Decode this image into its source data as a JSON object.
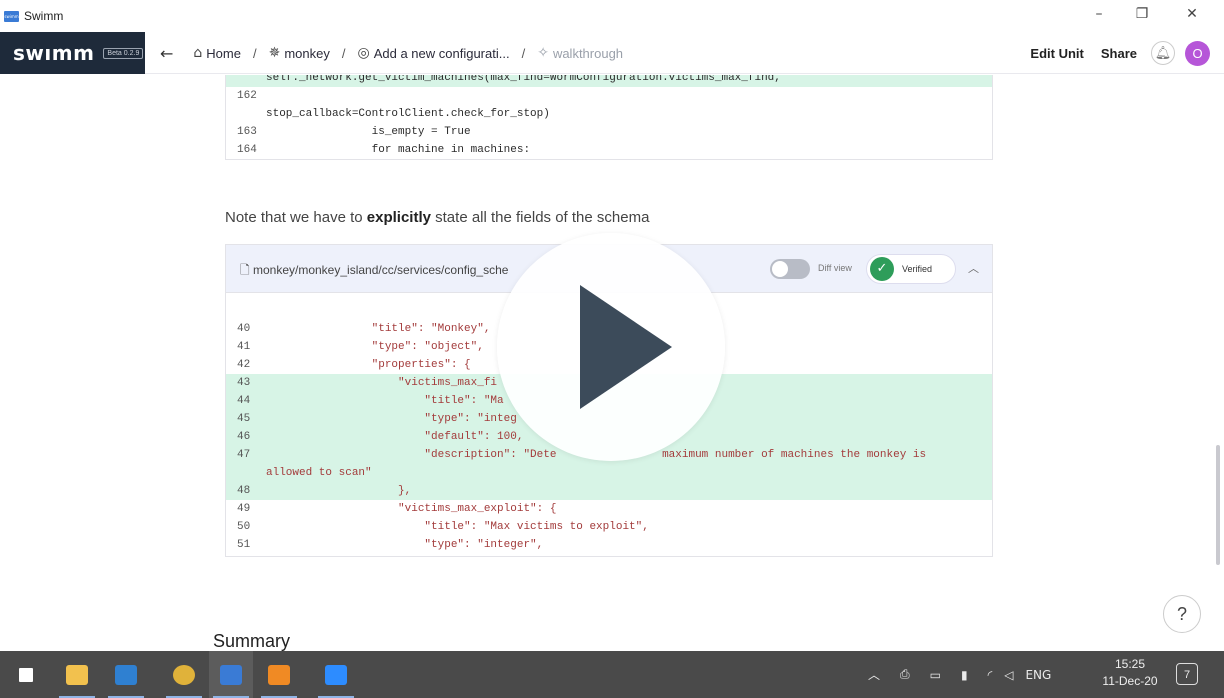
{
  "window": {
    "title": "Swimm"
  },
  "header": {
    "logo": "swımm",
    "version": "Beta 0.2.9",
    "breadcrumbs": [
      {
        "icon": "home-icon",
        "glyph": "⌂",
        "label": "Home"
      },
      {
        "icon": "monkey-icon",
        "glyph": "✵",
        "label": "monkey"
      },
      {
        "icon": "config-icon",
        "glyph": "◎",
        "label": "Add a new configurati..."
      },
      {
        "icon": "walkthrough-icon",
        "glyph": "✧",
        "label": "walkthrough"
      }
    ],
    "edit_unit": "Edit Unit",
    "share": "Share",
    "avatar_initial": "O"
  },
  "top_snippet": {
    "lines": [
      {
        "ln": "",
        "text": "self._network.get_victim_machines(max_find=WormConfiguration.victims_max_find,",
        "hl": true
      },
      {
        "ln": "162",
        "text": "",
        "hl": false
      },
      {
        "ln": "",
        "text": "stop_callback=ControlClient.check_for_stop)",
        "hl": false
      },
      {
        "ln": "163",
        "text": "                is_empty = True",
        "hl": false
      },
      {
        "ln": "164",
        "text": "                for machine in machines:",
        "hl": false
      }
    ]
  },
  "note": {
    "before": "Note that we have to ",
    "bold": "explicitly",
    "after": " state all the fields of the schema"
  },
  "snippet": {
    "file_name": "monkey/monkey_island/cc/services/config_sche",
    "diff_label": "Diff view",
    "verified_label": "Verified",
    "lines": [
      {
        "ln": "40",
        "text": "                \"title\": \"Monkey\",",
        "hl": false
      },
      {
        "ln": "41",
        "text": "                \"type\": \"object\",",
        "hl": false
      },
      {
        "ln": "42",
        "text": "                \"properties\": {",
        "hl": false
      },
      {
        "ln": "43",
        "text": "                    \"victims_max_fi",
        "hl": true
      },
      {
        "ln": "44",
        "text": "                        \"title\": \"Ma",
        "hl": true
      },
      {
        "ln": "45",
        "text": "                        \"type\": \"integ",
        "hl": true
      },
      {
        "ln": "46",
        "text": "                        \"default\": 100,",
        "hl": true
      },
      {
        "ln": "47",
        "text": "                        \"description\": \"Dete                maximum number of machines the monkey is",
        "hl": true
      },
      {
        "ln": "",
        "text": "allowed to scan\"",
        "hl": true
      },
      {
        "ln": "48",
        "text": "                    },",
        "hl": true
      },
      {
        "ln": "49",
        "text": "                    \"victims_max_exploit\": {",
        "hl": false
      },
      {
        "ln": "50",
        "text": "                        \"title\": \"Max victims to exploit\",",
        "hl": false
      },
      {
        "ln": "51",
        "text": "                        \"type\": \"integer\",",
        "hl": false
      }
    ]
  },
  "summary_heading": "Summary",
  "help_label": "?",
  "taskbar": {
    "apps": [
      {
        "name": "start-button",
        "color": "#ffffff"
      },
      {
        "name": "file-explorer-icon",
        "color": "#f2c14e"
      },
      {
        "name": "vscode-icon",
        "color": "#2f80d1"
      },
      {
        "name": "chrome-icon",
        "color": "#e0b23a"
      },
      {
        "name": "swimm-taskbar-icon",
        "color": "#3a7bd5"
      },
      {
        "name": "sublime-icon",
        "color": "#f08a24"
      },
      {
        "name": "zoom-icon",
        "color": "#2d8cff"
      }
    ],
    "language": "ENG",
    "time": "15:25",
    "date": "11-Dec-20",
    "notification_count": "7"
  }
}
